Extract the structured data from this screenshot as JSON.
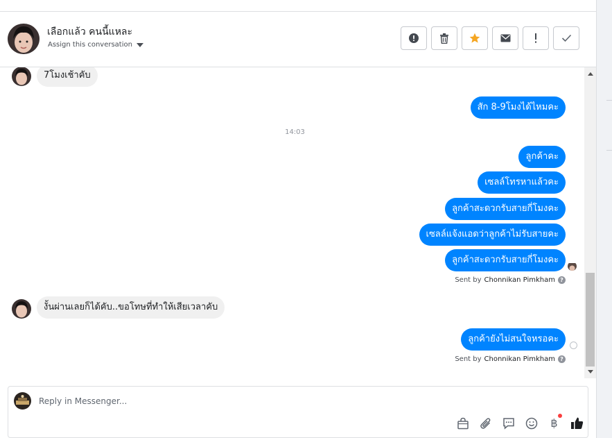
{
  "header": {
    "contact_name": "เลือกแล้ว คนนี้แหละ",
    "assign_label": "Assign this conversation",
    "actions": [
      "alert-circle-icon",
      "trash-icon",
      "star-icon",
      "envelope-icon",
      "exclamation-icon",
      "check-icon"
    ]
  },
  "conversation": {
    "messages": [
      {
        "direction": "incoming",
        "text": "7โมงเช้าคับ"
      },
      {
        "direction": "outgoing",
        "text": "สัก 8-9โมงได้ไหมคะ"
      },
      {
        "type": "timestamp",
        "text": "14:03"
      },
      {
        "direction": "outgoing",
        "text": "ลูกค้าคะ"
      },
      {
        "direction": "outgoing",
        "text": "เซลล์โทรหาแล้วคะ"
      },
      {
        "direction": "outgoing",
        "text": "ลูกค้าสะดวกรับสายกี่โมงคะ"
      },
      {
        "direction": "outgoing",
        "text": "เซลล์แจ้งแอดว่าลูกค้าไม่รับสายคะ"
      },
      {
        "direction": "outgoing",
        "text": "ลูกค้าสะดวกรับสายกี่โมงคะ"
      },
      {
        "direction": "incoming",
        "text": "งั้นผ่านเลยก็ได้คับ..ขอโทษที่ทำให้เสียเวลาคับ"
      },
      {
        "direction": "outgoing",
        "text": "ลูกค้ายังไม่สนใจหรอคะ"
      }
    ],
    "sent_by_prefix": "Sent by",
    "sent_by_name": "Chonnikan Pimkham",
    "help_mark": "?"
  },
  "composer": {
    "placeholder": "Reply in Messenger...",
    "tools": [
      "shopping-bag-icon",
      "paperclip-icon",
      "chat-bubble-icon",
      "emoji-icon",
      "baht-icon",
      "thumbs-up-icon"
    ],
    "baht_symbol": "฿"
  },
  "colors": {
    "outgoing_bubble": "#0084ff",
    "incoming_bubble": "#f0f0f0",
    "star": "#f5a623",
    "notification_dot": "#fa3e3e"
  }
}
